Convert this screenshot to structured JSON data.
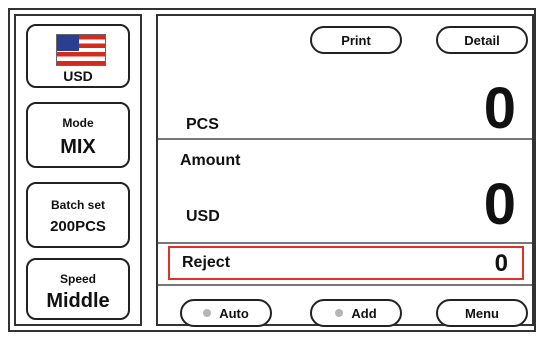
{
  "currency_tile": {
    "code": "USD",
    "flag_icon": "us-flag-icon"
  },
  "mode_tile": {
    "label": "Mode",
    "value": "MIX"
  },
  "batch_tile": {
    "label": "Batch set",
    "value": "200PCS"
  },
  "speed_tile": {
    "label": "Speed",
    "value": "Middle"
  },
  "top_buttons": {
    "print": "Print",
    "detail": "Detail"
  },
  "counts": {
    "pcs_label": "PCS",
    "pcs_value": "0",
    "amount_label": "Amount",
    "currency_label": "USD",
    "amount_value": "0"
  },
  "reject": {
    "label": "Reject",
    "value": "0",
    "highlight_color": "#e0302c"
  },
  "bottom_buttons": {
    "auto": "Auto",
    "add": "Add",
    "menu": "Menu"
  }
}
